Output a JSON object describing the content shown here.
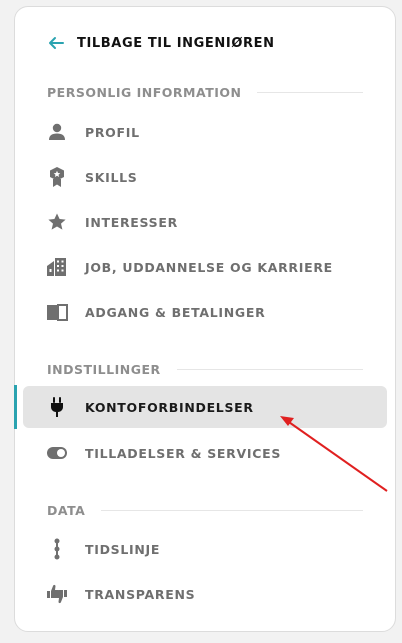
{
  "back": {
    "label": "TILBAGE TIL INGENIØREN",
    "icon": "arrow-left-icon",
    "color": "#2aa3b0"
  },
  "sections": {
    "personal": {
      "title": "PERSONLIG INFORMATION",
      "items": [
        {
          "label": "PROFIL",
          "icon": "person-icon"
        },
        {
          "label": "SKILLS",
          "icon": "badge-icon"
        },
        {
          "label": "INTERESSER",
          "icon": "star-icon"
        },
        {
          "label": "JOB, UDDANNELSE OG KARRIERE",
          "icon": "building-icon"
        },
        {
          "label": "ADGANG & BETALINGER",
          "icon": "book-icon"
        }
      ]
    },
    "settings": {
      "title": "INDSTILLINGER",
      "items": [
        {
          "label": "KONTOFORBINDELSER",
          "icon": "plug-icon",
          "active": true
        },
        {
          "label": "TILLADELSER & SERVICES",
          "icon": "toggle-icon"
        }
      ]
    },
    "data": {
      "title": "DATA",
      "items": [
        {
          "label": "TIDSLINJE",
          "icon": "timeline-icon"
        },
        {
          "label": "TRANSPARENS",
          "icon": "thumbs-icon"
        }
      ]
    }
  },
  "colors": {
    "accent": "#2aa3b0",
    "active_bg": "#e4e4e4",
    "annotation_arrow": "#e02020"
  }
}
